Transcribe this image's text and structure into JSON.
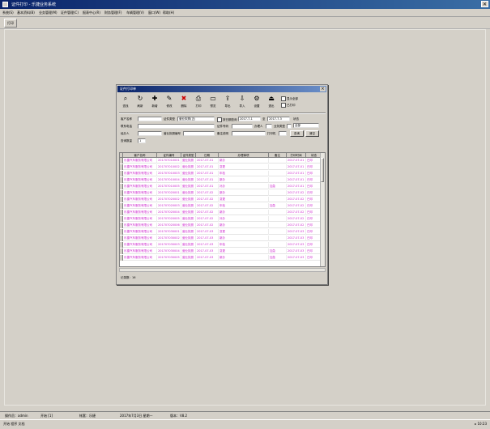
{
  "app": {
    "title": "证件打印 - 乐捷业务系统"
  },
  "menubar": {
    "items": [
      "系统(S)",
      "基本资料(B)",
      "业务管理(M)",
      "证件管理(C)",
      "报表中心(R)",
      "财务管理(F)",
      "车辆管理(V)",
      "窗口(W)",
      "帮助(H)"
    ]
  },
  "toolbar": {
    "first_button": "打印"
  },
  "dialog": {
    "title": "证件打印单",
    "tools": [
      {
        "icon": "search-icon",
        "glyph": "⌕",
        "label": "查找"
      },
      {
        "icon": "refresh-icon",
        "glyph": "↻",
        "label": "刷新"
      },
      {
        "icon": "add-icon",
        "glyph": "✚",
        "label": "新增"
      },
      {
        "icon": "edit-icon",
        "glyph": "✎",
        "label": "修改"
      },
      {
        "icon": "delete-icon",
        "glyph": "✖",
        "label": "删除"
      },
      {
        "icon": "print-icon",
        "glyph": "⎙",
        "label": "打印"
      },
      {
        "icon": "preview-icon",
        "glyph": "▭",
        "label": "预览"
      },
      {
        "icon": "export-icon",
        "glyph": "⇪",
        "label": "导出"
      },
      {
        "icon": "import-icon",
        "glyph": "⇩",
        "label": "导入"
      },
      {
        "icon": "settings-icon",
        "glyph": "⚙",
        "label": "设置"
      },
      {
        "icon": "exit-icon",
        "glyph": "⏏",
        "label": "退出"
      }
    ],
    "check_show_all": "显示全部",
    "check_printed": "已打印",
    "filters": {
      "f1_label": "客户名称",
      "f1_value": "",
      "f1b_label": "证件类型",
      "f1b_value": "营业执照(正)",
      "date_check_label": "按日期查询",
      "date_from": "2017-7-1",
      "date_to_label": "至",
      "date_to": "2017-7-3",
      "status_label": "状态",
      "status_value": "全部",
      "f2_label": "联系电话",
      "f2_value": "",
      "f2b_label": "证件号码",
      "f2b_value": "",
      "f2c_label": "办理人",
      "f2c_value": "",
      "f2d_label": "业务类型",
      "f2d_value": "",
      "f3_label": "经办人",
      "f3_value": "",
      "f3b_label": "营业执照编号",
      "f3b_value": "",
      "f3c_label": "备注说明",
      "f3c_value": "",
      "f3d_label": "打印机",
      "f3d_value": "",
      "f4_label": "查询数量",
      "f4_value": "1",
      "btn_query": "查询",
      "btn_clear": "清空"
    },
    "grid": {
      "headers": [
        "客户名称",
        "证件编号",
        "证件类型",
        "日期",
        "办理事项",
        "备注",
        "打印时间",
        "状态"
      ],
      "rows": [
        [
          "乐捷汽车服务有限公司",
          "201707010001",
          "营业执照",
          "2017-07-01",
          "新办",
          "",
          "2017-07-01",
          "已印"
        ],
        [
          "乐捷汽车服务有限公司",
          "201707010002",
          "营业执照",
          "2017-07-01",
          "变更",
          "",
          "2017-07-01",
          "已印"
        ],
        [
          "乐捷汽车服务有限公司",
          "201707010003",
          "营业执照",
          "2017-07-01",
          "年检",
          "",
          "2017-07-01",
          "已印"
        ],
        [
          "乐捷汽车服务有限公司",
          "201707010004",
          "营业执照",
          "2017-07-01",
          "新办",
          "",
          "2017-07-01",
          "已印"
        ],
        [
          "乐捷汽车服务有限公司",
          "201707010005",
          "营业执照",
          "2017-07-01",
          "补办",
          "加急",
          "2017-07-01",
          "已印"
        ],
        [
          "乐捷汽车服务有限公司",
          "201707020001",
          "营业执照",
          "2017-07-02",
          "新办",
          "",
          "2017-07-02",
          "已印"
        ],
        [
          "乐捷汽车服务有限公司",
          "201707020002",
          "营业执照",
          "2017-07-02",
          "变更",
          "",
          "2017-07-02",
          "已印"
        ],
        [
          "乐捷汽车服务有限公司",
          "201707020003",
          "营业执照",
          "2017-07-02",
          "年检",
          "加急",
          "2017-07-02",
          "已印"
        ],
        [
          "乐捷汽车服务有限公司",
          "201707020004",
          "营业执照",
          "2017-07-02",
          "新办",
          "",
          "2017-07-02",
          "已印"
        ],
        [
          "乐捷汽车服务有限公司",
          "201707020005",
          "营业执照",
          "2017-07-02",
          "补办",
          "",
          "2017-07-02",
          "已印"
        ],
        [
          "乐捷汽车服务有限公司",
          "201707020006",
          "营业执照",
          "2017-07-02",
          "新办",
          "",
          "2017-07-02",
          "已印"
        ],
        [
          "乐捷汽车服务有限公司",
          "201707030001",
          "营业执照",
          "2017-07-03",
          "变更",
          "",
          "2017-07-03",
          "已印"
        ],
        [
          "乐捷汽车服务有限公司",
          "201707030002",
          "营业执照",
          "2017-07-03",
          "新办",
          "",
          "2017-07-03",
          "已印"
        ],
        [
          "乐捷汽车服务有限公司",
          "201707030003",
          "营业执照",
          "2017-07-03",
          "年检",
          "",
          "2017-07-03",
          "已印"
        ],
        [
          "乐捷汽车服务有限公司",
          "201707030004",
          "营业执照",
          "2017-07-03",
          "变更",
          "加急",
          "2017-07-03",
          "已印"
        ],
        [
          "乐捷汽车服务有限公司",
          "201707030005",
          "营业执照",
          "2017-07-03",
          "新办",
          "加急",
          "2017-07-03",
          "已印"
        ]
      ]
    },
    "footer_count": "记录数：16"
  },
  "taskbar": {
    "items": [
      "操作员：admin",
      "开始 [1]",
      "帐套：乐捷",
      "2017年7月3日 星期一",
      "版本：V8.2"
    ]
  },
  "statusbar": {
    "left": "开始  程序  文档",
    "right": "▸ 10:23"
  },
  "colors": {
    "title_blue": "#0a246a",
    "row_text": "#cc22cc"
  }
}
